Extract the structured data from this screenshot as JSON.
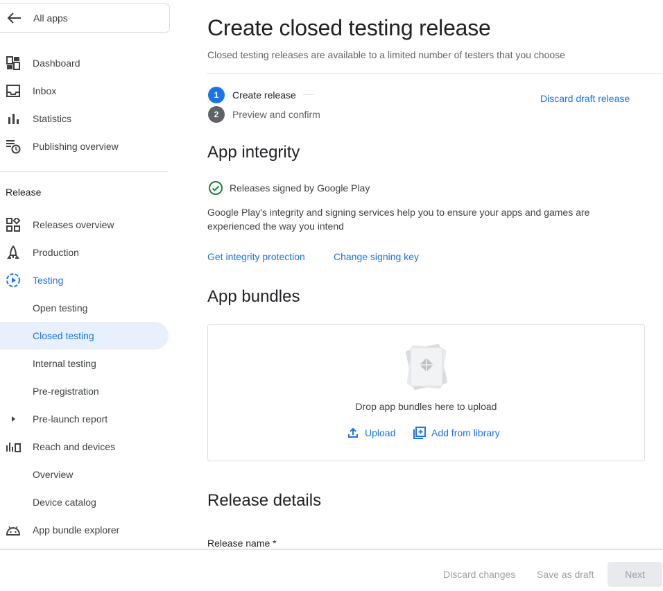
{
  "sidebar": {
    "all_apps": "All apps",
    "top_items": [
      {
        "label": "Dashboard",
        "icon": "dashboard-icon"
      },
      {
        "label": "Inbox",
        "icon": "inbox-icon"
      },
      {
        "label": "Statistics",
        "icon": "bar-chart-icon"
      },
      {
        "label": "Publishing overview",
        "icon": "publishing-overview-icon"
      }
    ],
    "section": "Release",
    "release_items": [
      {
        "label": "Releases overview",
        "icon": "releases-overview-icon"
      },
      {
        "label": "Production",
        "icon": "production-icon"
      },
      {
        "label": "Testing",
        "icon": "testing-icon"
      },
      {
        "label": "Open testing"
      },
      {
        "label": "Closed testing"
      },
      {
        "label": "Internal testing"
      },
      {
        "label": "Pre-registration"
      },
      {
        "label": "Pre-launch report",
        "icon": "caret-right-icon"
      },
      {
        "label": "Reach and devices",
        "icon": "reach-devices-icon"
      },
      {
        "label": "Overview"
      },
      {
        "label": "Device catalog"
      },
      {
        "label": "App bundle explorer",
        "icon": "android-icon"
      }
    ]
  },
  "main": {
    "title": "Create closed testing release",
    "subtitle": "Closed testing releases are available to a limited number of testers that you choose",
    "steps": [
      {
        "num": "1",
        "label": "Create release"
      },
      {
        "num": "2",
        "label": "Preview and confirm"
      }
    ],
    "discard_draft": "Discard draft release",
    "integrity": {
      "heading": "App integrity",
      "status": "Releases signed by Google Play",
      "description": "Google Play's integrity and signing services help you to ensure your apps and games are experienced the way you intend",
      "link1": "Get integrity protection",
      "link2": "Change signing key"
    },
    "bundles": {
      "heading": "App bundles",
      "drop_text": "Drop app bundles here to upload",
      "upload": "Upload",
      "add_library": "Add from library"
    },
    "details": {
      "heading": "Release details",
      "release_name_label": "Release name  *"
    }
  },
  "footer": {
    "discard": "Discard changes",
    "save": "Save as draft",
    "next": "Next"
  },
  "colors": {
    "accent": "#1a73e8",
    "active_bg": "#e8f0fe",
    "success": "#188038",
    "step_inactive": "#5f6368"
  }
}
